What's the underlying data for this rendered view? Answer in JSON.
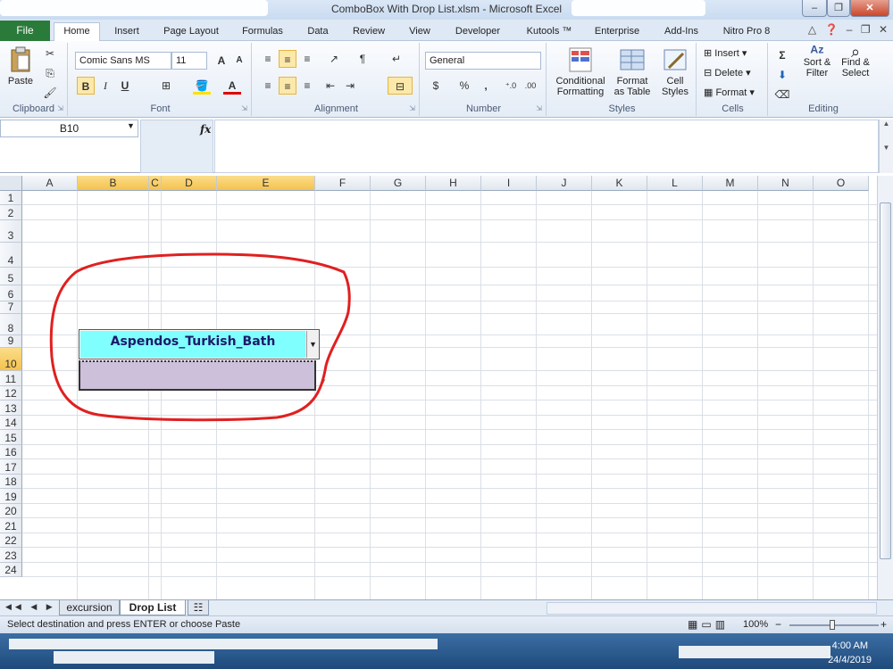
{
  "window": {
    "title": "ComboBox With Drop List.xlsm - Microsoft Excel",
    "minimize": "–",
    "restore": "❐",
    "close": "✕"
  },
  "tabs": {
    "file": "File",
    "items": [
      "Home",
      "Insert",
      "Page Layout",
      "Formulas",
      "Data",
      "Review",
      "View",
      "Developer",
      "Kutools ™",
      "Enterprise",
      "Add-Ins",
      "Nitro Pro 8"
    ],
    "active": "Home"
  },
  "ribbon": {
    "clipboard": {
      "label": "Clipboard",
      "paste": "Paste"
    },
    "font": {
      "label": "Font",
      "name": "Comic Sans MS",
      "size": "11",
      "bold": "B",
      "italic": "I",
      "underline": "U",
      "grow": "A",
      "shrink": "A"
    },
    "alignment": {
      "label": "Alignment"
    },
    "number": {
      "label": "Number",
      "format": "General",
      "currency": "$",
      "percent": "%",
      "comma": ",",
      "inc": "⁺.0",
      "dec": ".00"
    },
    "styles": {
      "label": "Styles",
      "conditional": "Conditional",
      "conditional2": "Formatting",
      "format_table": "Format",
      "format_table2": "as Table",
      "cell_styles": "Cell",
      "cell_styles2": "Styles"
    },
    "cells": {
      "label": "Cells",
      "insert": "Insert",
      "delete": "Delete",
      "format": "Format"
    },
    "editing": {
      "label": "Editing",
      "sort": "Sort &",
      "sort2": "Filter",
      "find": "Find &",
      "find2": "Select"
    }
  },
  "formula_bar": {
    "name_box": "B10",
    "fx": "fx",
    "value": ""
  },
  "columns": [
    "A",
    "B",
    "C",
    "D",
    "E",
    "F",
    "G",
    "H",
    "I",
    "J",
    "K",
    "L",
    "M",
    "N",
    "O"
  ],
  "selected_columns": [
    "B",
    "C",
    "D",
    "E"
  ],
  "rows": [
    "1",
    "2",
    "3",
    "4",
    "5",
    "6",
    "7",
    "8",
    "9",
    "10",
    "11",
    "12",
    "13",
    "14",
    "15",
    "16",
    "17",
    "18",
    "19",
    "20",
    "21",
    "22",
    "23",
    "24"
  ],
  "selected_row": "10",
  "combo": {
    "value": "Aspendos_Turkish_Bath",
    "fill": "#80ffff",
    "list_fill": "#ccc0da"
  },
  "sheets": {
    "tabs": [
      "excursion",
      "Drop List"
    ],
    "active": "Drop List"
  },
  "status": {
    "text": "Select destination and press ENTER or choose Paste",
    "zoom": "100%",
    "zoom_minus": "−",
    "zoom_plus": "+"
  },
  "taskbar": {
    "time": "4:00 AM",
    "date": "24/4/2019"
  },
  "annotation_color": "#e02020"
}
